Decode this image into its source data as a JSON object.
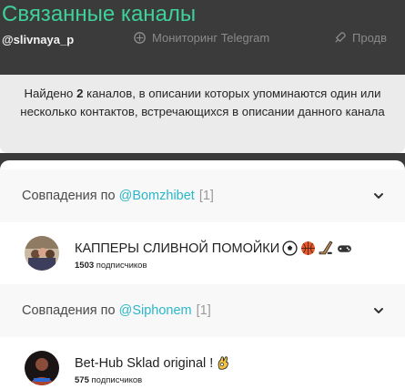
{
  "background": {
    "title": "Связанные каналы",
    "handle": "@slivnaya_p",
    "nav": [
      {
        "label": "Мониторинг Telegram",
        "icon": "monitor-icon"
      },
      {
        "label": "Продв",
        "icon": "rocket-icon"
      }
    ]
  },
  "info": {
    "prefix": "Найдено ",
    "count": "2",
    "suffix": " каналов, в описании которых упоминаются один или несколько контактов, встречающихся в описании данного канала"
  },
  "groups": [
    {
      "prefix": "Совпадения по",
      "mention": "@Bomzhibet",
      "count": "[1]",
      "channel": {
        "name": "КАППЕРЫ СЛИВНОЙ ПОМОЙКИ",
        "emojis": [
          "soccer-ball-icon",
          "basketball-icon",
          "hockey-stick-icon",
          "gamepad-icon"
        ],
        "subscribers": "1503",
        "subscribers_label": "подписчиков"
      }
    },
    {
      "prefix": "Совпадения по",
      "mention": "@Siphonem",
      "count": "[1]",
      "channel": {
        "name": "Bet-Hub Sklad original !",
        "emojis": [
          "ok-hand-icon"
        ],
        "subscribers": "575",
        "subscribers_label": "подписчиков"
      }
    }
  ],
  "colors": {
    "accent": "#3ed19a",
    "mention": "#2bb6c9",
    "overlay": "#3b3b3b"
  }
}
